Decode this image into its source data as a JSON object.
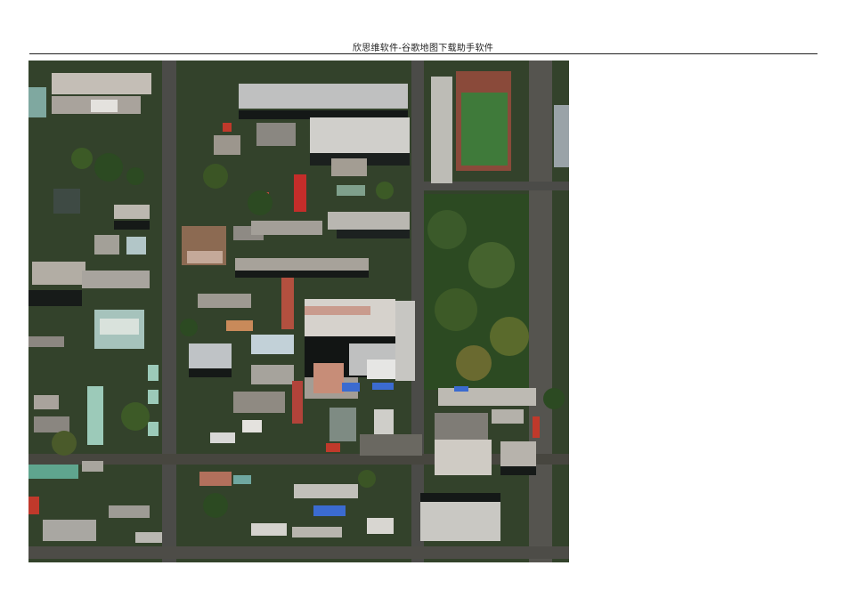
{
  "header": {
    "text": "欣思维软件-谷歌地图下载助手软件"
  },
  "image": {
    "kind": "satellite-map",
    "colors": {
      "vegetation": "#2f4a22",
      "road": "#4a4a48",
      "roof_light": "#c9c7c2",
      "roof_red": "#b5322b",
      "sports_field": "#3f7a3a",
      "shadow": "#141817"
    }
  }
}
